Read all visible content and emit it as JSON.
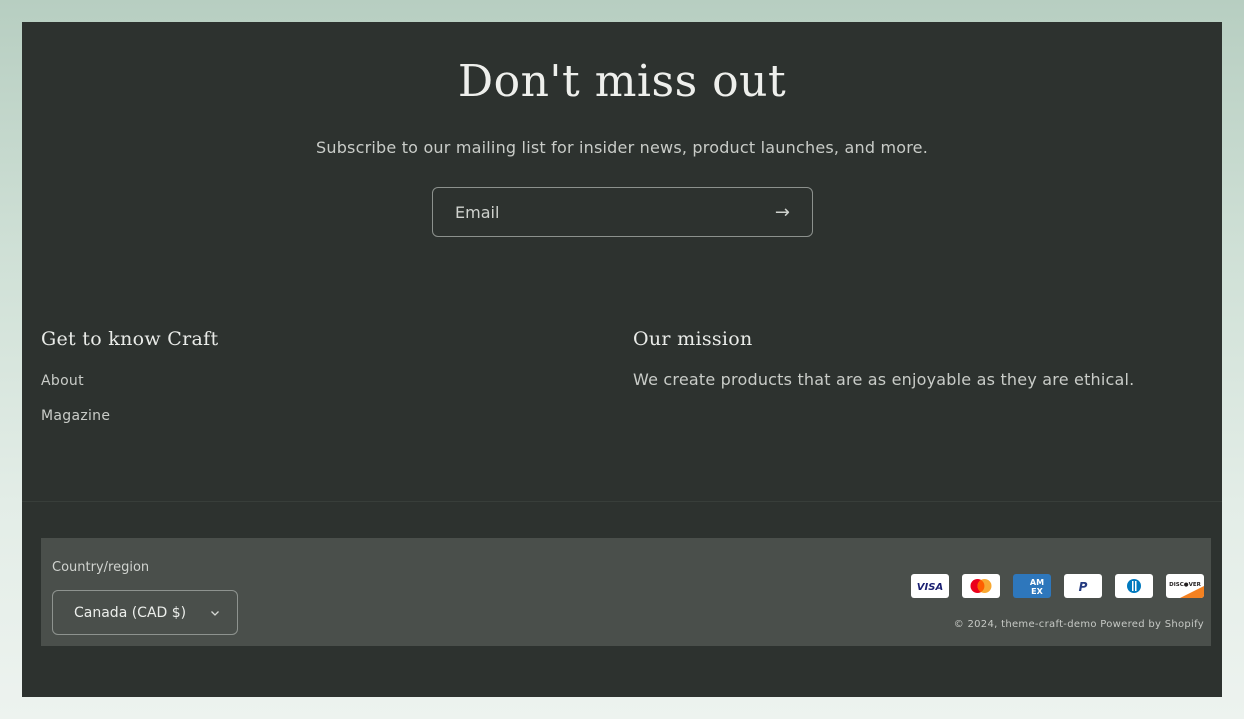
{
  "newsletter": {
    "title": "Don't miss out",
    "subtitle": "Subscribe to our mailing list for insider news, product launches, and more.",
    "email_placeholder": "Email",
    "email_value": "",
    "submit_icon": "arrow-right-icon",
    "submit_glyph": "→"
  },
  "footer_columns": {
    "left": {
      "heading": "Get to know Craft",
      "links": [
        {
          "label": "About"
        },
        {
          "label": "Magazine"
        }
      ]
    },
    "right": {
      "heading": "Our mission",
      "text": "We create products that are as enjoyable as they are ethical."
    }
  },
  "bottom": {
    "country_label": "Country/region",
    "country_selected": "Canada (CAD $)",
    "payment_methods": [
      {
        "name": "Visa",
        "icon": "visa-icon"
      },
      {
        "name": "Mastercard",
        "icon": "mastercard-icon"
      },
      {
        "name": "American Express",
        "icon": "amex-icon"
      },
      {
        "name": "PayPal",
        "icon": "paypal-icon"
      },
      {
        "name": "Diners Club",
        "icon": "diners-club-icon"
      },
      {
        "name": "Discover",
        "icon": "discover-icon"
      }
    ],
    "copyright_prefix": "© 2024, ",
    "store_link": "theme-craft-demo",
    "powered_by": "Powered by Shopify"
  },
  "colors": {
    "footer_bg": "#2d322f",
    "bottom_bar_bg": "#4a4f4b",
    "text_light": "#e9ebe8",
    "text_muted": "#c9ccc8",
    "visa_blue": "#1a1f71",
    "mastercard_red": "#eb001b",
    "mastercard_orange": "#f79e1b",
    "amex_blue": "#2e77bc",
    "paypal_blue": "#253b80",
    "diners_blue": "#0079be",
    "discover_orange": "#f48120"
  }
}
